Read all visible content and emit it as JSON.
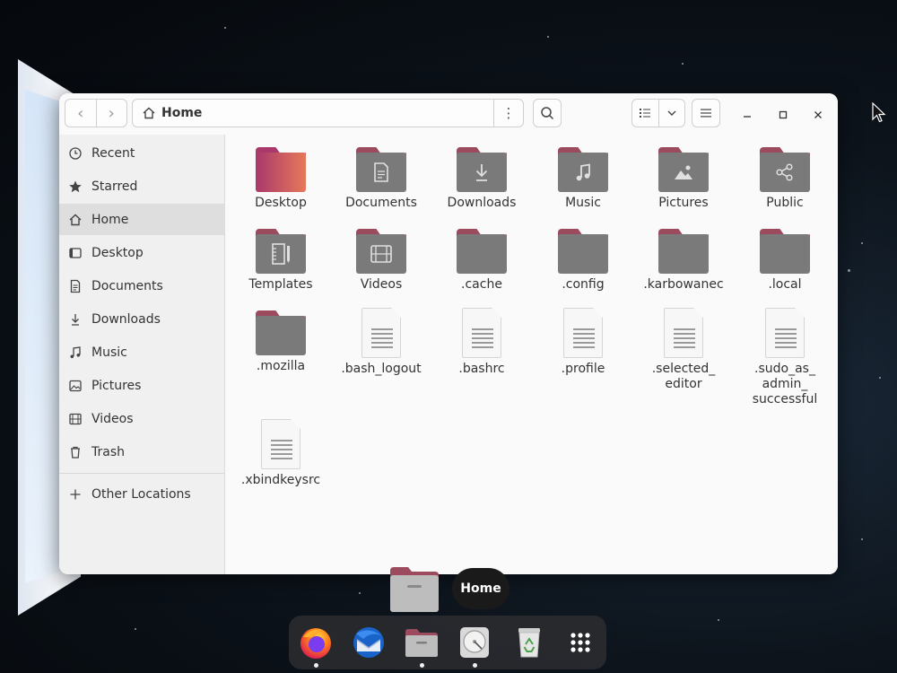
{
  "window": {
    "path_label": "Home"
  },
  "sidebar": {
    "items": [
      {
        "label": "Recent"
      },
      {
        "label": "Starred"
      },
      {
        "label": "Home"
      },
      {
        "label": "Desktop"
      },
      {
        "label": "Documents"
      },
      {
        "label": "Downloads"
      },
      {
        "label": "Music"
      },
      {
        "label": "Pictures"
      },
      {
        "label": "Videos"
      },
      {
        "label": "Trash"
      }
    ],
    "other_locations": "Other Locations"
  },
  "content": {
    "items": [
      {
        "label": "Desktop",
        "type": "folder",
        "icon": "desktop"
      },
      {
        "label": "Documents",
        "type": "folder",
        "icon": "document"
      },
      {
        "label": "Downloads",
        "type": "folder",
        "icon": "download"
      },
      {
        "label": "Music",
        "type": "folder",
        "icon": "music"
      },
      {
        "label": "Pictures",
        "type": "folder",
        "icon": "picture"
      },
      {
        "label": "Public",
        "type": "folder",
        "icon": "share"
      },
      {
        "label": "Templates",
        "type": "folder",
        "icon": "template"
      },
      {
        "label": "Videos",
        "type": "folder",
        "icon": "film"
      },
      {
        "label": ".cache",
        "type": "folder",
        "icon": "none"
      },
      {
        "label": ".config",
        "type": "folder",
        "icon": "none"
      },
      {
        "label": ".karbowanec",
        "type": "folder",
        "icon": "none"
      },
      {
        "label": ".local",
        "type": "folder",
        "icon": "none"
      },
      {
        "label": ".mozilla",
        "type": "folder",
        "icon": "none"
      },
      {
        "label": ".bash_logout",
        "type": "file"
      },
      {
        "label": ".bashrc",
        "type": "file"
      },
      {
        "label": ".profile",
        "type": "file"
      },
      {
        "label": ".selected_\neditor",
        "type": "file"
      },
      {
        "label": ".sudo_as_\nadmin_\nsuccessful",
        "type": "file"
      },
      {
        "label": ".xbindkeysrc",
        "type": "file"
      }
    ]
  },
  "overview": {
    "tooltip": "Home"
  },
  "dock": {
    "apps": [
      "firefox-icon",
      "thunderbird-icon",
      "files-icon",
      "disk-icon",
      "trash-icon",
      "app-grid-icon"
    ]
  },
  "colors": {
    "folder_tab": "#9c4a5e",
    "folder_body": "#7a7a7a",
    "sidebar_active": "#dedede"
  }
}
